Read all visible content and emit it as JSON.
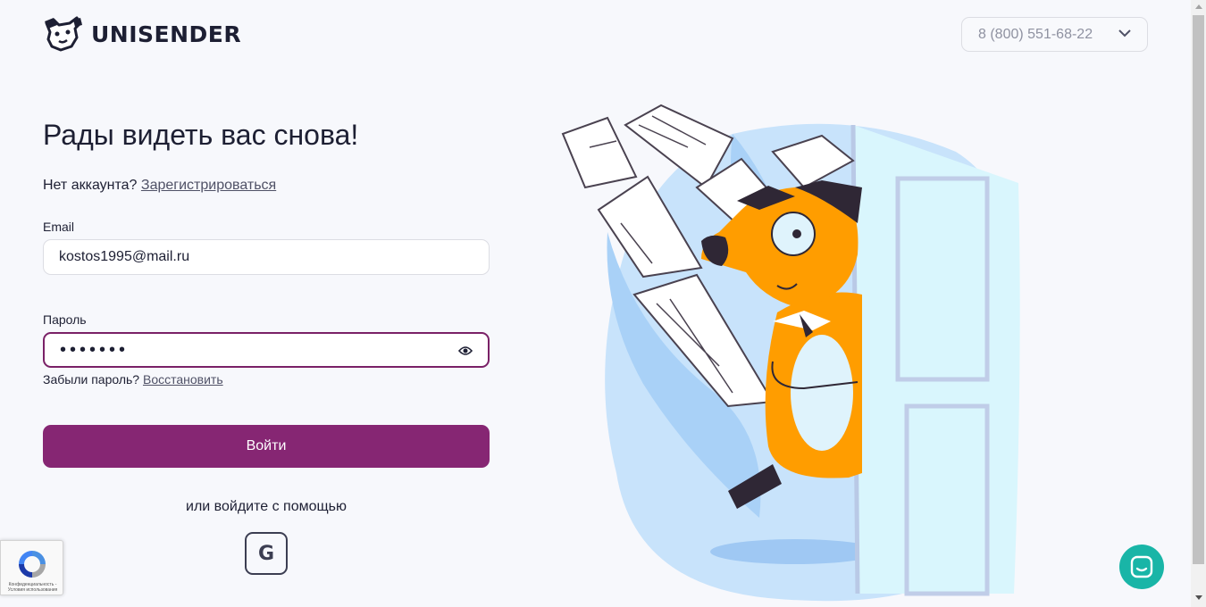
{
  "header": {
    "logo_text": "UNISENDER",
    "phone": "8 (800) 551-68-22"
  },
  "login": {
    "heading": "Рады видеть вас снова!",
    "no_account_text": "Нет аккаунта?",
    "register_link": "Зарегистрироваться",
    "email_label": "Email",
    "email_value": "kostos1995@mail.ru",
    "password_label": "Пароль",
    "password_masked": "•••••••",
    "forgot_text": "Забыли пароль?",
    "restore_link": "Восстановить",
    "submit_label": "Войти",
    "or_text": "или войдите с помощью",
    "google_label": "G"
  },
  "recaptcha": {
    "text": "Конфиденциальность - Условия использования"
  },
  "colors": {
    "primary": "#862673",
    "focus_border": "#7a2167",
    "chat": "#19b5a7",
    "fox": "#ff9d00",
    "text": "#1d1f33"
  },
  "icons": {
    "logo": "dog-head-logo-icon",
    "chevron": "chevron-down-icon",
    "eye": "eye-icon",
    "google": "google-icon",
    "chat": "chat-bubble-icon",
    "recaptcha": "recaptcha-icon"
  }
}
